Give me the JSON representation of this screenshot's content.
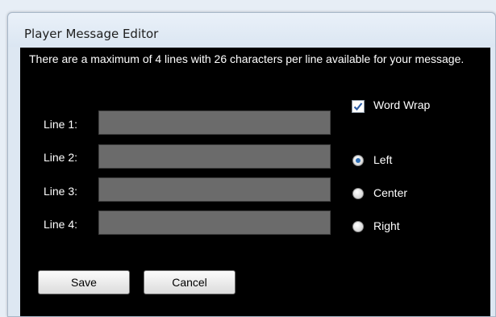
{
  "window": {
    "title": "Player Message Editor"
  },
  "description": "There are a maximum of 4 lines with 26 characters per line available for your message.",
  "lines": [
    {
      "label": "Line 1:",
      "value": ""
    },
    {
      "label": "Line 2:",
      "value": ""
    },
    {
      "label": "Line 3:",
      "value": ""
    },
    {
      "label": "Line 4:",
      "value": ""
    }
  ],
  "word_wrap": {
    "label": "Word Wrap",
    "checked": true
  },
  "alignment": {
    "options": [
      "Left",
      "Center",
      "Right"
    ],
    "selected": "Left"
  },
  "buttons": {
    "save": "Save",
    "cancel": "Cancel"
  },
  "colors": {
    "panel_background": "#000000",
    "field_background": "#6b6b6b",
    "text": "#ffffff",
    "accent": "#2f6fb6"
  }
}
